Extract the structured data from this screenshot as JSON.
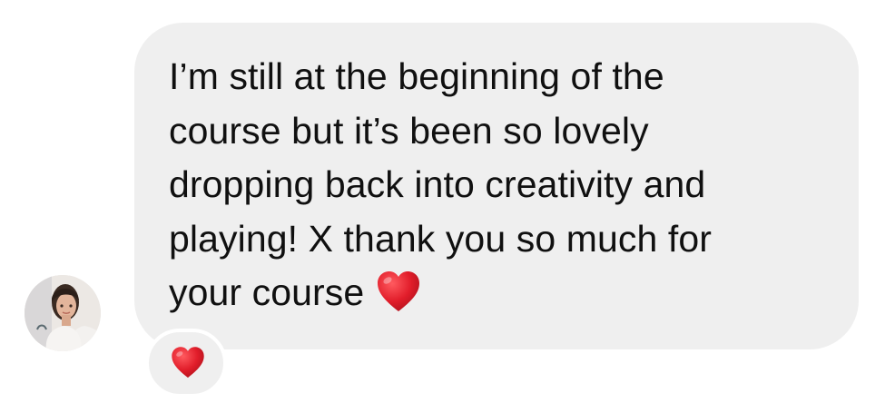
{
  "message": {
    "lines": [
      "I’m still at the beginning of the",
      "course but it’s been so lovely",
      "dropping back into creativity and",
      "playing! X thank you so much for",
      "your course"
    ],
    "emoji": "heart-emoji"
  },
  "reaction": {
    "emoji": "heart-emoji"
  },
  "colors": {
    "bubble": "#efefef",
    "text": "#101010",
    "heart": "#e11d2a"
  }
}
